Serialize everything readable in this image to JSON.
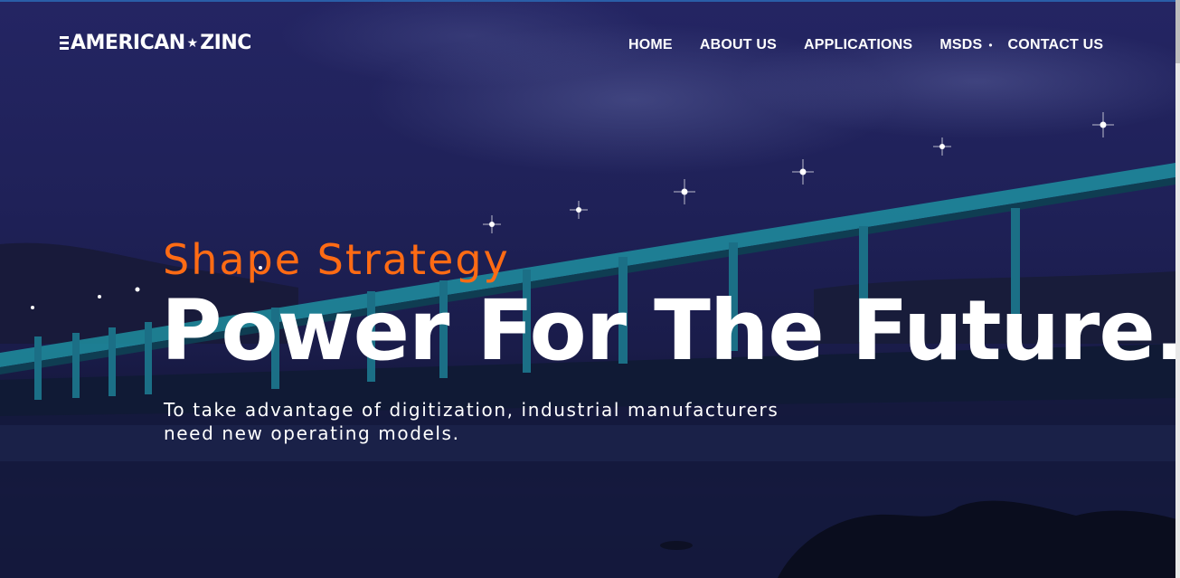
{
  "brand": {
    "logo_left": "AMERICAN",
    "logo_star": "★",
    "logo_right": "ZINC"
  },
  "nav": {
    "items": [
      {
        "label": "HOME"
      },
      {
        "label": "ABOUT US"
      },
      {
        "label": "APPLICATIONS"
      },
      {
        "label": "MSDS"
      },
      {
        "label": "CONTACT US"
      }
    ]
  },
  "hero": {
    "eyebrow": "Shape Strategy",
    "headline": "Power For The Future.",
    "subtext": "To take advantage of digitization, industrial manufacturers need new operating models."
  },
  "colors": {
    "accent": "#ff6b14",
    "sky": "#242563",
    "text": "#ffffff"
  }
}
